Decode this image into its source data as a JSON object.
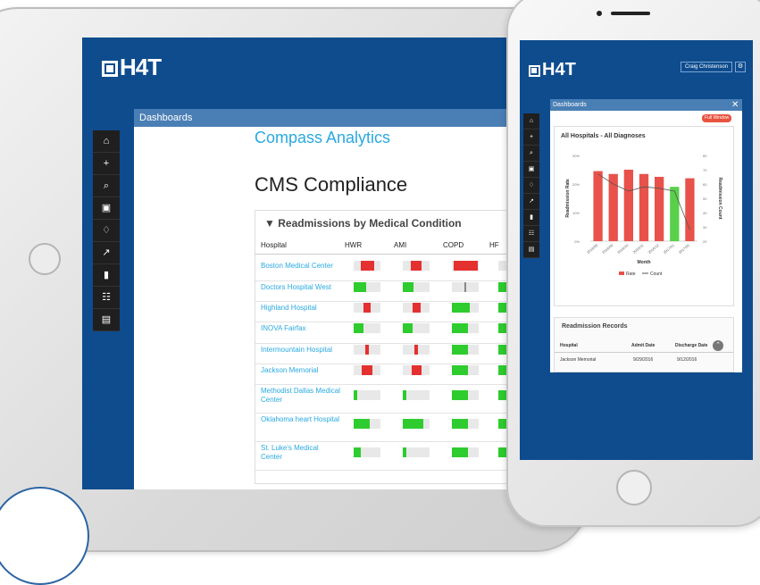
{
  "tablet": {
    "logo": "H4T",
    "nav_title": "Dashboards",
    "brand": "Compass Analytics",
    "page_title": "CMS Compliance",
    "card_title": "Readmissions by Medical Condition",
    "filter_icon": "filter-icon",
    "columns": [
      "Hospital",
      "HWR",
      "AMI",
      "COPD",
      "HF"
    ],
    "sidebar_icons": [
      "home-icon",
      "plus-icon",
      "search-icon",
      "briefcase-icon",
      "bell-icon",
      "chart-icon",
      "pill-icon",
      "clipboard-icon",
      "document-icon"
    ],
    "rows": [
      {
        "name": "Boston Medical Center",
        "cells": [
          {
            "color": "red",
            "level": 0.5
          },
          {
            "color": "red",
            "level": 0.4
          },
          {
            "color": "red",
            "level": 0.9
          },
          {
            "color": "red",
            "level": 0.3
          }
        ]
      },
      {
        "name": "Doctors Hospital West",
        "cells": [
          {
            "color": "green",
            "level": 0.45
          },
          {
            "color": "green",
            "level": 0.4
          },
          {
            "color": "gray",
            "level": 0.05
          },
          {
            "color": "green",
            "level": 0.3
          }
        ]
      },
      {
        "name": "Highland Hospital",
        "cells": [
          {
            "color": "red",
            "level": 0.25
          },
          {
            "color": "red",
            "level": 0.3
          },
          {
            "color": "green",
            "level": 0.65
          },
          {
            "color": "green",
            "level": 0.3
          }
        ]
      },
      {
        "name": "INOVA Fairfax",
        "cells": [
          {
            "color": "green",
            "level": 0.35
          },
          {
            "color": "green",
            "level": 0.35
          },
          {
            "color": "green",
            "level": 0.6
          },
          {
            "color": "green",
            "level": 0.5
          }
        ]
      },
      {
        "name": "Intermountain Hospital",
        "cells": [
          {
            "color": "red",
            "level": 0.12
          },
          {
            "color": "red",
            "level": 0.12
          },
          {
            "color": "green",
            "level": 0.6
          },
          {
            "color": "green",
            "level": 0.3
          }
        ]
      },
      {
        "name": "Jackson Memorial",
        "cells": [
          {
            "color": "red",
            "level": 0.4
          },
          {
            "color": "red",
            "level": 0.35
          },
          {
            "color": "green",
            "level": 0.6
          },
          {
            "color": "green",
            "level": 0.3
          }
        ]
      },
      {
        "name": "Methodist Dallas Medical Center",
        "cells": [
          {
            "color": "green",
            "level": 0.12
          },
          {
            "color": "green",
            "level": 0.12
          },
          {
            "color": "green",
            "level": 0.6
          },
          {
            "color": "green",
            "level": 0.3
          }
        ]
      },
      {
        "name": "Oklahoma heart Hospital",
        "cells": [
          {
            "color": "green",
            "level": 0.6
          },
          {
            "color": "green",
            "level": 0.75
          },
          {
            "color": "green",
            "level": 0.6
          },
          {
            "color": "green",
            "level": 0.3
          }
        ]
      },
      {
        "name": "St. Luke's Medical Center",
        "cells": [
          {
            "color": "green",
            "level": 0.25
          },
          {
            "color": "green",
            "level": 0.12
          },
          {
            "color": "green",
            "level": 0.6
          },
          {
            "color": "green",
            "level": 0.3
          }
        ]
      }
    ]
  },
  "phone": {
    "logo": "H4T",
    "user_name": "Craig Christenson",
    "modal_title": "Dashboards",
    "full_window_label": "Full Window",
    "chart_title": "All Hospitals - All Diagnoses",
    "rec_title": "Readmission Records",
    "rec_columns": [
      "Hospital",
      "Admit Date",
      "Discharge Date"
    ],
    "rec_row": [
      "Jackson Memorial",
      "9/29/2016",
      "9/12/2016"
    ],
    "sidebar_icons": [
      "home-icon",
      "plus-icon",
      "search-icon",
      "briefcase-icon",
      "bell-icon",
      "chart-icon",
      "pill-icon",
      "clipboard-icon",
      "document-icon"
    ]
  },
  "chart_data": {
    "type": "bar",
    "title": "All Hospitals - All Diagnoses",
    "categories": [
      "2016/08",
      "2016/09",
      "2016/10",
      "2016/11",
      "2016/12",
      "2017/01",
      "2017/02"
    ],
    "xlabel": "Month",
    "ylabel": "Readmission Rate",
    "y2label": "Readmission Count",
    "ylim": [
      0,
      30
    ],
    "y2lim": [
      20,
      80
    ],
    "yticks": [
      "0%",
      "10%",
      "20%",
      "30%"
    ],
    "y2ticks": [
      "20",
      "30",
      "40",
      "50",
      "60",
      "70",
      "80"
    ],
    "series": [
      {
        "name": "Rate",
        "type": "bar",
        "color": "#e8524a",
        "values": [
          24.5,
          23.5,
          25.0,
          23.5,
          22.5,
          19.0,
          22.0
        ]
      },
      {
        "name": "Count",
        "type": "line",
        "color": "#555555",
        "values": [
          67,
          60,
          55,
          58,
          57,
          55,
          28
        ]
      }
    ],
    "bar_highlight": {
      "index": 5,
      "color": "#58d04a"
    },
    "legend": "bottom"
  }
}
